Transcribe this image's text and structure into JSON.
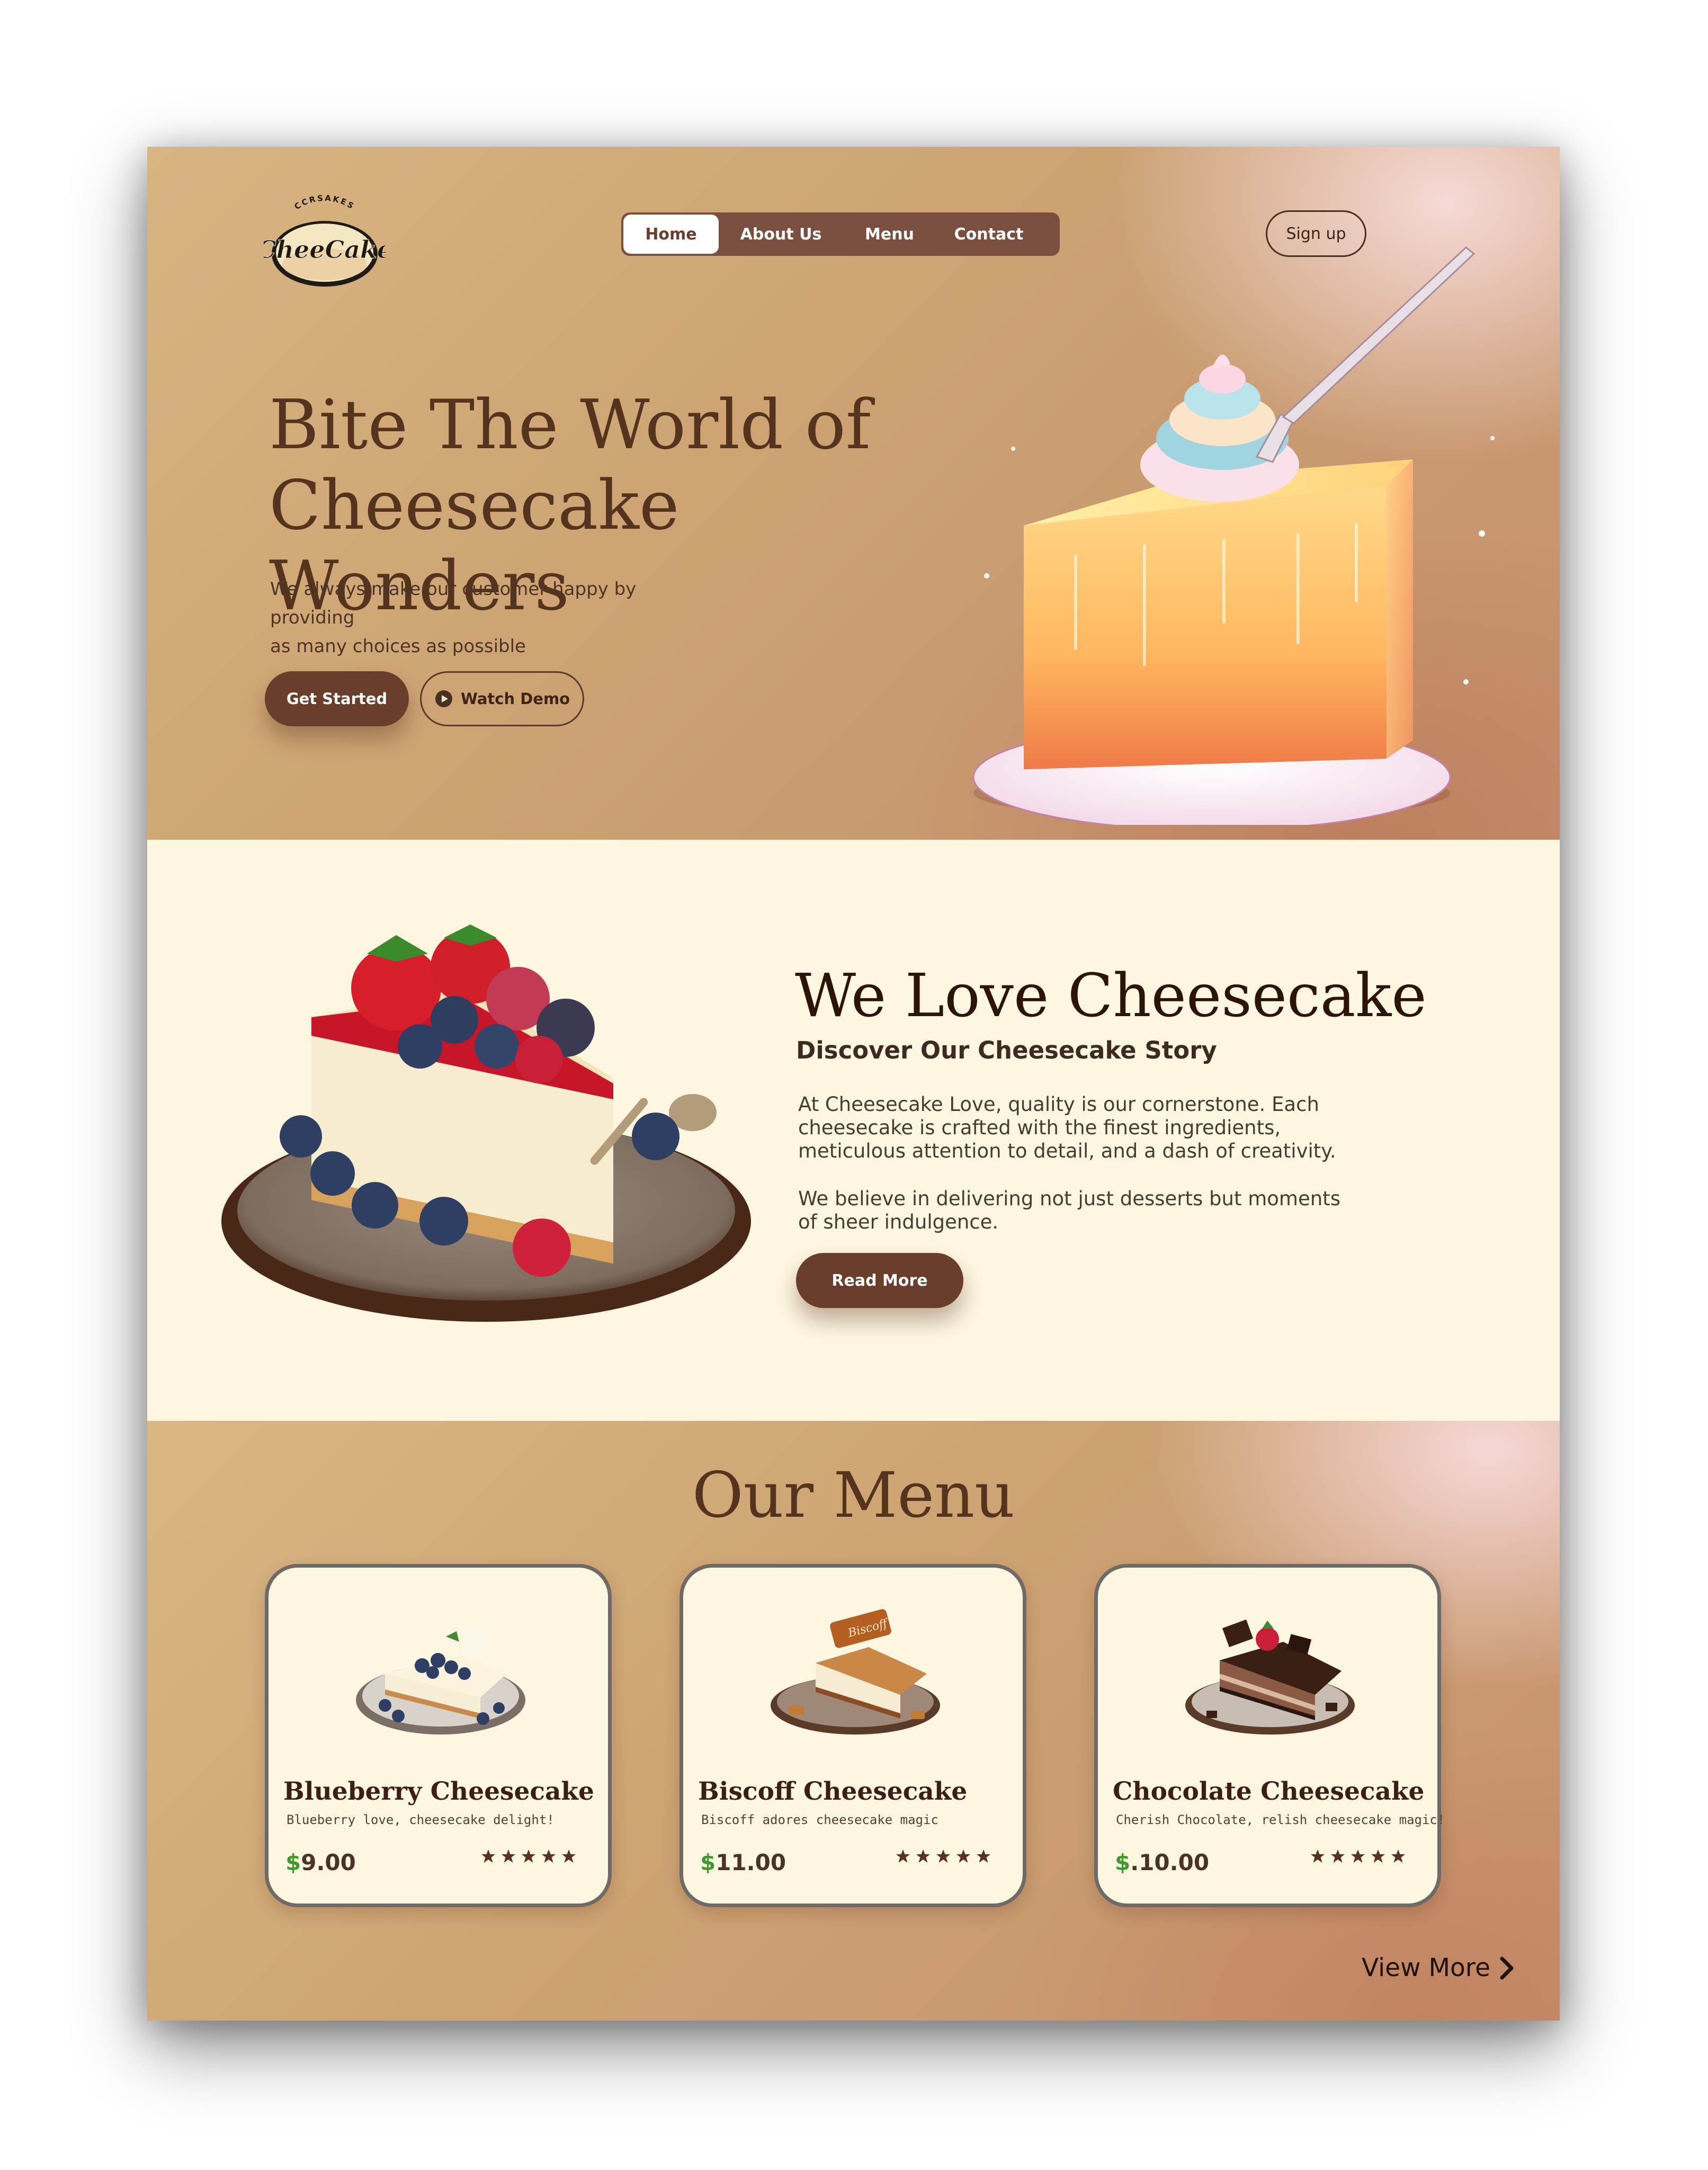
{
  "brand": {
    "logo_arc": "CCRSAKES",
    "logo_word": "CheeCake"
  },
  "nav": {
    "items": [
      {
        "label": "Home",
        "active": true
      },
      {
        "label": "About Us",
        "active": false
      },
      {
        "label": "Menu",
        "active": false
      },
      {
        "label": "Contact",
        "active": false
      }
    ],
    "signup_label": "Sign up"
  },
  "hero": {
    "title_line1": "Bite The World of",
    "title_line2": "Cheesecake Wonders",
    "subtitle_line1": "We always make our customer happy by providing",
    "subtitle_line2": "as many choices as possible",
    "primary_button": "Get Started",
    "secondary_button": "Watch Demo",
    "secondary_icon": "play-icon"
  },
  "about": {
    "title": "We Love Cheesecake",
    "subtitle": "Discover Our Cheesecake Story",
    "paragraph1": "At Cheesecake Love, quality is our cornerstone. Each cheesecake is crafted with the finest ingredients, meticulous attention to detail, and a dash of creativity.",
    "paragraph2": "We believe in delivering not just desserts but moments of sheer indulgence.",
    "button": "Read More"
  },
  "menu": {
    "title": "Our Menu",
    "currency": "$",
    "items": [
      {
        "name": "Blueberry Cheesecake",
        "description": "Blueberry love, cheesecake delight!",
        "price": "9.00",
        "rating": 5
      },
      {
        "name": "Biscoff Cheesecake",
        "description": "Biscoff adores cheesecake magic",
        "price": "11.00",
        "rating": 5
      },
      {
        "name": "Chocolate Cheesecake",
        "description": "Cherish Chocolate, relish cheesecake magic!",
        "price": ".10.00",
        "rating": 5
      }
    ],
    "view_more": "View More",
    "view_more_icon": "chevron-right-icon"
  },
  "colors": {
    "brown_dark": "#6a3e2b",
    "nav_bg": "#7b4f40",
    "cream": "#fdf6e0",
    "price_currency": "#3f9a2e",
    "star": "#5a3222"
  }
}
